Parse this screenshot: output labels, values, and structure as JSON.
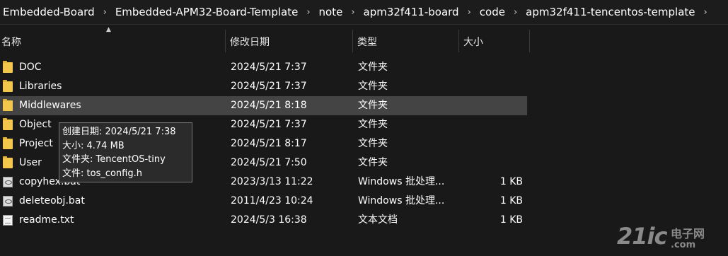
{
  "breadcrumb": [
    "Embedded-Board",
    "Embedded-APM32-Board-Template",
    "note",
    "apm32f411-board",
    "code",
    "apm32f411-tencentos-template"
  ],
  "breadcrumb_separator": "›",
  "columns": {
    "name": "名称",
    "date": "修改日期",
    "type": "类型",
    "size": "大小"
  },
  "sort_icon": "chevron-up-icon",
  "files": [
    {
      "name": "DOC",
      "date": "2024/5/21 7:37",
      "type": "文件夹",
      "size": "",
      "icon": "folder-icon"
    },
    {
      "name": "Libraries",
      "date": "2024/5/21 7:37",
      "type": "文件夹",
      "size": "",
      "icon": "folder-icon"
    },
    {
      "name": "Middlewares",
      "date": "2024/5/21 8:18",
      "type": "文件夹",
      "size": "",
      "icon": "folder-icon"
    },
    {
      "name": "Object",
      "date": "2024/5/21 7:37",
      "type": "文件夹",
      "size": "",
      "icon": "folder-icon"
    },
    {
      "name": "Project",
      "date": "2024/5/21 8:17",
      "type": "文件夹",
      "size": "",
      "icon": "folder-icon"
    },
    {
      "name": "User",
      "date": "2024/5/21 7:50",
      "type": "文件夹",
      "size": "",
      "icon": "folder-icon"
    },
    {
      "name": "copyhex.bat",
      "date": "2023/3/13 11:22",
      "type": "Windows 批处理...",
      "size": "1 KB",
      "icon": "batch-file-icon"
    },
    {
      "name": "deleteobj.bat",
      "date": "2011/4/23 10:24",
      "type": "Windows 批处理...",
      "size": "1 KB",
      "icon": "batch-file-icon"
    },
    {
      "name": "readme.txt",
      "date": "2024/5/3 16:38",
      "type": "文本文档",
      "size": "1 KB",
      "icon": "text-file-icon"
    }
  ],
  "hovered_row": 2,
  "tooltip": {
    "created": "创建日期: 2024/5/21 7:38",
    "size": "大小: 4.74 MB",
    "folders": "文件夹: TencentOS-tiny",
    "files": "文件: tos_config.h"
  },
  "watermark": {
    "main": "21ic",
    "cn": "电子网",
    "domain": ".com"
  }
}
